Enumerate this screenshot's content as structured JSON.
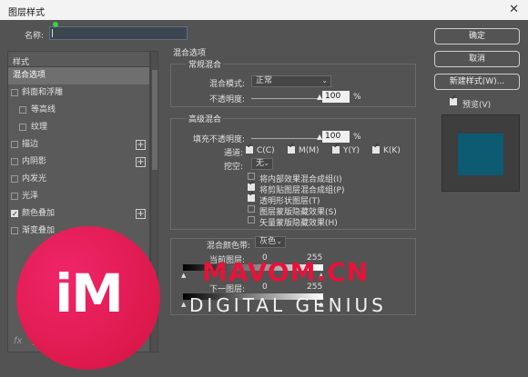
{
  "window": {
    "title": "图层样式",
    "close_glyph": "✕"
  },
  "name_field": {
    "label": "名称:",
    "value": ""
  },
  "left_panel": {
    "header": "样式",
    "items": [
      {
        "label": "混合选项",
        "checkbox": false,
        "checked": false,
        "plus": false,
        "active": true,
        "indent": 0
      },
      {
        "label": "斜面和浮雕",
        "checkbox": true,
        "checked": false,
        "plus": false,
        "active": false,
        "indent": 0
      },
      {
        "label": "等高线",
        "checkbox": true,
        "checked": false,
        "plus": false,
        "active": false,
        "indent": 1
      },
      {
        "label": "纹理",
        "checkbox": true,
        "checked": false,
        "plus": false,
        "active": false,
        "indent": 1
      },
      {
        "label": "描边",
        "checkbox": true,
        "checked": false,
        "plus": true,
        "active": false,
        "indent": 0
      },
      {
        "label": "内阴影",
        "checkbox": true,
        "checked": false,
        "plus": true,
        "active": false,
        "indent": 0
      },
      {
        "label": "内发光",
        "checkbox": true,
        "checked": false,
        "plus": false,
        "active": false,
        "indent": 0
      },
      {
        "label": "光泽",
        "checkbox": true,
        "checked": false,
        "plus": false,
        "active": false,
        "indent": 0
      },
      {
        "label": "颜色叠加",
        "checkbox": true,
        "checked": true,
        "plus": true,
        "active": false,
        "indent": 0
      },
      {
        "label": "渐变叠加",
        "checkbox": true,
        "checked": false,
        "plus": false,
        "active": false,
        "indent": 0
      }
    ],
    "footer": {
      "fx": "fx",
      "up": "▲",
      "down": "▼",
      "trash": "🗑"
    }
  },
  "blend": {
    "section_title": "混合选项",
    "general": {
      "title": "常规混合",
      "mode_label": "混合模式:",
      "mode_value": "正常",
      "opacity_label": "不透明度:",
      "opacity_value": "100",
      "opacity_unit": "%",
      "opacity_level": 1.0
    },
    "advanced": {
      "title": "高级混合",
      "fill_label": "填充不透明度:",
      "fill_value": "100",
      "fill_unit": "%",
      "fill_level": 1.0,
      "channels_label": "通道:",
      "channels": [
        {
          "label": "C(C)",
          "checked": true
        },
        {
          "label": "M(M)",
          "checked": true
        },
        {
          "label": "Y(Y)",
          "checked": true
        },
        {
          "label": "K(K)",
          "checked": true
        }
      ],
      "knockout_label": "挖空:",
      "knockout_value": "无",
      "options": [
        {
          "label": "将内部效果混合成组(I)",
          "checked": false
        },
        {
          "label": "将剪贴图层混合成组(P)",
          "checked": true
        },
        {
          "label": "透明形状图层(T)",
          "checked": true
        },
        {
          "label": "图层蒙版隐藏效果(S)",
          "checked": false
        },
        {
          "label": "矢量蒙版隐藏效果(H)",
          "checked": false
        }
      ]
    },
    "blend_if": {
      "label": "混合颜色带:",
      "value": "灰色",
      "this_layer": {
        "label": "当前图层:",
        "low": "0",
        "high": "255"
      },
      "underlying": {
        "label": "下一图层:",
        "low": "0",
        "high": "255"
      }
    }
  },
  "buttons": {
    "ok": "确定",
    "cancel": "取消",
    "new_style": "新建样式(W)..."
  },
  "preview": {
    "label": "预览(V)",
    "checked": true,
    "swatch_color": "#0d5a73"
  },
  "watermark": {
    "logo": "iM",
    "line1": "MAVOM.CN",
    "line2": "DIGITAL GENIUS"
  }
}
